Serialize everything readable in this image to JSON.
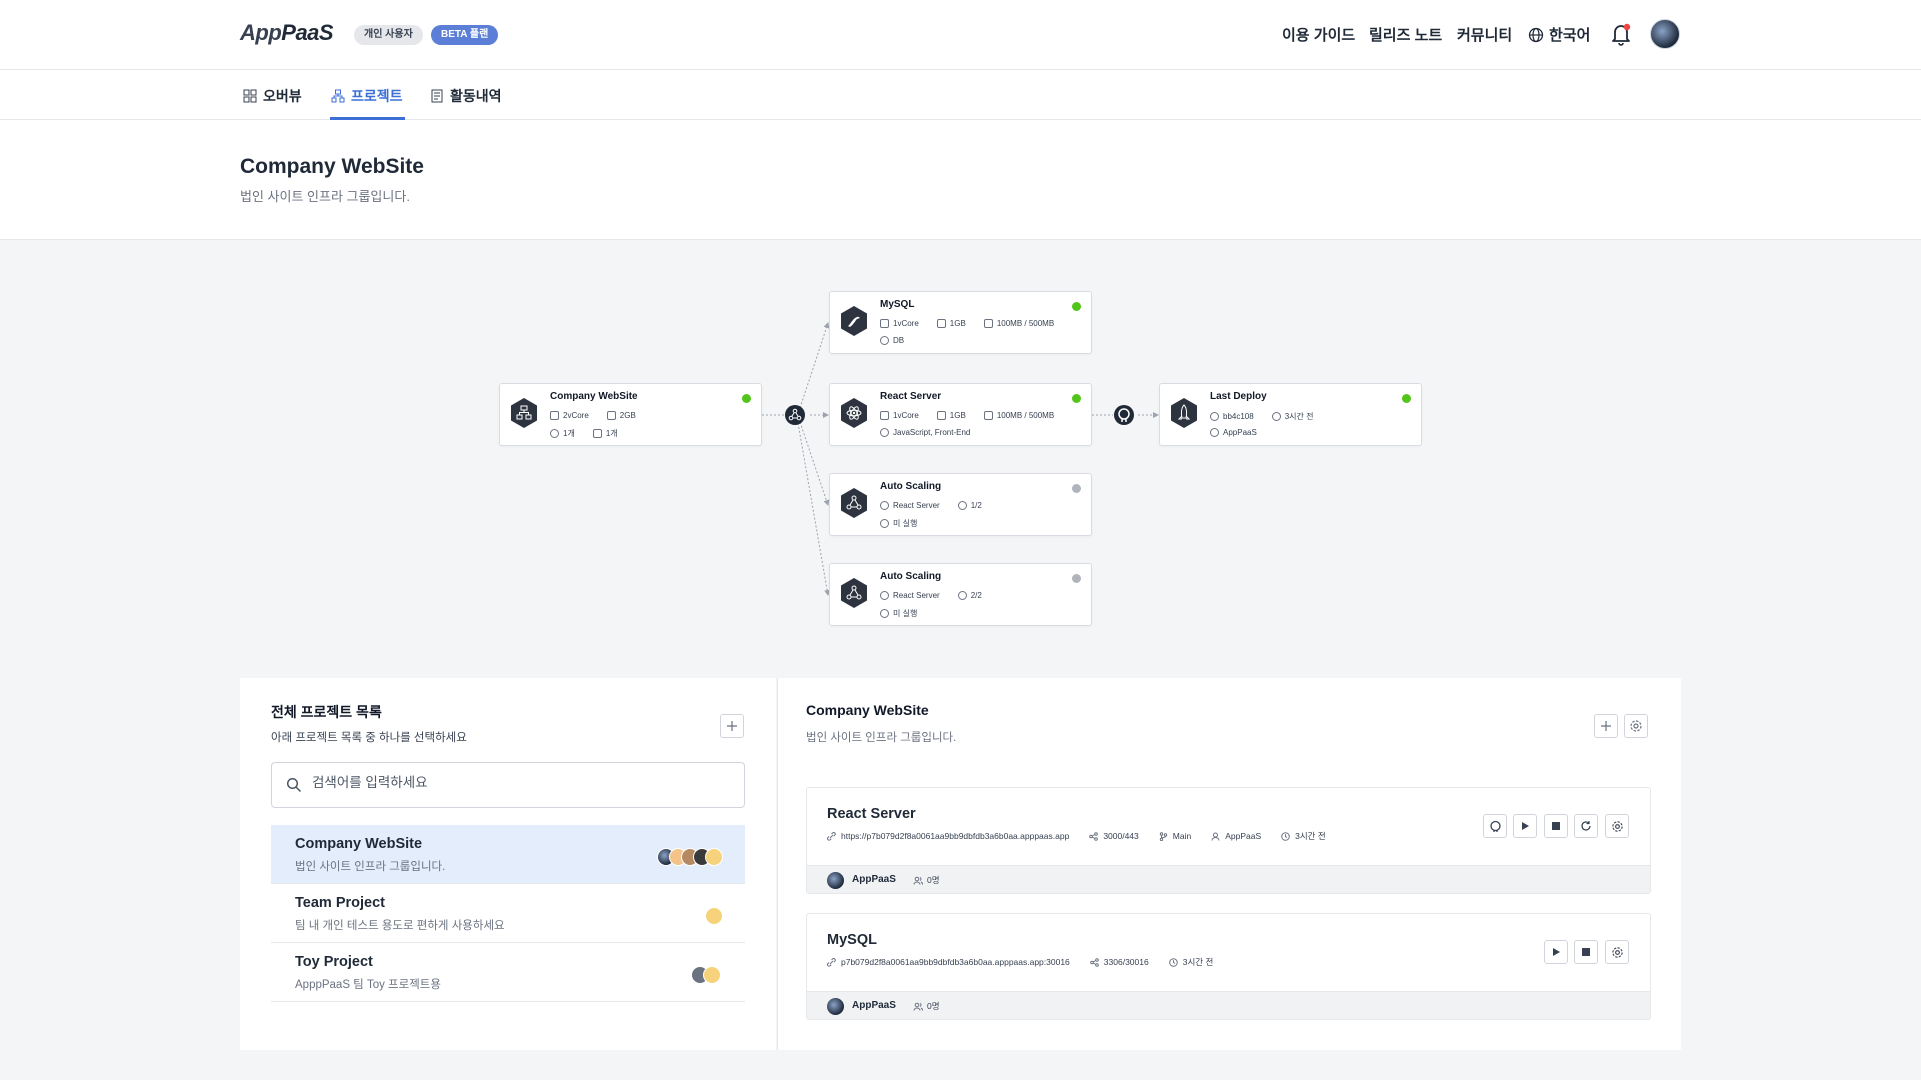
{
  "header": {
    "logo_app": "App",
    "logo_paas": "PaaS",
    "badge_user": "개인 사용자",
    "badge_beta": "BETA 플랜",
    "nav": {
      "guide": "이용 가이드",
      "release": "릴리즈 노트",
      "community": "커뮤니티",
      "language": "한국어"
    }
  },
  "tabs": {
    "overview": "오버뷰",
    "project": "프로젝트",
    "activity": "활동내역"
  },
  "page": {
    "title": "Company WebSite",
    "subtitle": "법인 사이트 인프라 그룹입니다."
  },
  "diagram": {
    "root": {
      "title": "Company WebSite",
      "cpu": "2vCore",
      "mem": "2GB",
      "views": "1개",
      "storage": "1개",
      "status_color": "#52c41a"
    },
    "mysql": {
      "title": "MySQL",
      "cpu": "1vCore",
      "mem": "1GB",
      "disk": "100MB / 500MB",
      "tag": "DB",
      "status_color": "#52c41a"
    },
    "react": {
      "title": "React Server",
      "cpu": "1vCore",
      "mem": "1GB",
      "disk": "100MB / 500MB",
      "tag": "JavaScript, Front-End",
      "status_color": "#52c41a"
    },
    "scale1": {
      "title": "Auto Scaling",
      "target": "React Server",
      "count": "1/2",
      "state": "미 실행",
      "status_color": "#b0b4bc"
    },
    "scale2": {
      "title": "Auto Scaling",
      "target": "React Server",
      "count": "2/2",
      "state": "미 실행",
      "status_color": "#b0b4bc"
    },
    "deploy": {
      "title": "Last Deploy",
      "commit": "bb4c108",
      "time": "3시간 전",
      "user": "AppPaaS",
      "status_color": "#52c41a"
    }
  },
  "left_panel": {
    "title": "전체 프로젝트 목록",
    "subtitle": "아래 프로젝트 목록 중 하나를 선택하세요",
    "search_placeholder": "검색어를 입력하세요",
    "projects": [
      {
        "name": "Company WebSite",
        "desc": "법인 사이트 인프라 그룹입니다."
      },
      {
        "name": "Team Project",
        "desc": "팀 내 개인 테스트 용도로 편하게 사용하세요"
      },
      {
        "name": "Toy Project",
        "desc": "ApppPaaS 팀 Toy 프로젝트용"
      }
    ]
  },
  "right_panel": {
    "title": "Company WebSite",
    "subtitle": "법인 사이트 인프라 그룹입니다.",
    "services": [
      {
        "name": "React Server",
        "url": "https://p7b079d2f8a0061aa9bb9dbfdb3a6b0aa.apppaas.app",
        "port": "3000/443",
        "branch": "Main",
        "user": "AppPaaS",
        "time": "3시간 전",
        "owner": "AppPaaS",
        "members": "0명"
      },
      {
        "name": "MySQL",
        "url": "p7b079d2f8a0061aa9bb9dbfdb3a6b0aa.apppaas.app:30016",
        "port": "3306/30016",
        "time": "3시간 전",
        "owner": "AppPaaS",
        "members": "0명"
      }
    ]
  },
  "colors": {
    "accent": "#3b6fd6",
    "beta_badge": "#5b7fd6",
    "selected_row": "#e3edfb",
    "status_ok": "#52c41a",
    "status_off": "#b0b4bc",
    "notification": "#ef4444"
  }
}
